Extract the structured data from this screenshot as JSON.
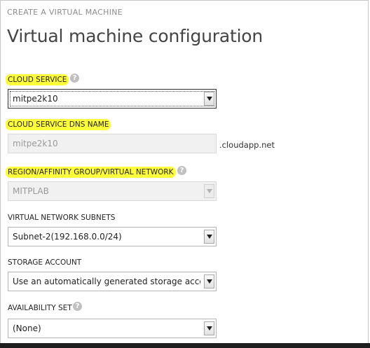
{
  "header": {
    "breadcrumb": "CREATE A VIRTUAL MACHINE",
    "title": "Virtual machine configuration"
  },
  "colors": {
    "highlight": "#ffff3c",
    "help_icon": "#c0c0c0"
  },
  "form": {
    "cloud_service": {
      "label": "CLOUD SERVICE",
      "value": "mitpe2k10",
      "help_icon": "question-icon"
    },
    "dns_name": {
      "label": "CLOUD SERVICE DNS NAME",
      "value": "mitpe2k10",
      "suffix": ".cloudapp.net"
    },
    "region": {
      "label": "REGION/AFFINITY GROUP/VIRTUAL NETWORK",
      "value": "MITPLAB",
      "help_icon": "question-icon"
    },
    "subnets": {
      "label": "VIRTUAL NETWORK SUBNETS",
      "value": "Subnet-2(192.168.0.0/24)"
    },
    "storage": {
      "label": "STORAGE ACCOUNT",
      "value": "Use an automatically generated storage account"
    },
    "availability": {
      "label": "AVAILABILITY SET",
      "value": "(None)",
      "help_icon": "question-icon"
    }
  }
}
